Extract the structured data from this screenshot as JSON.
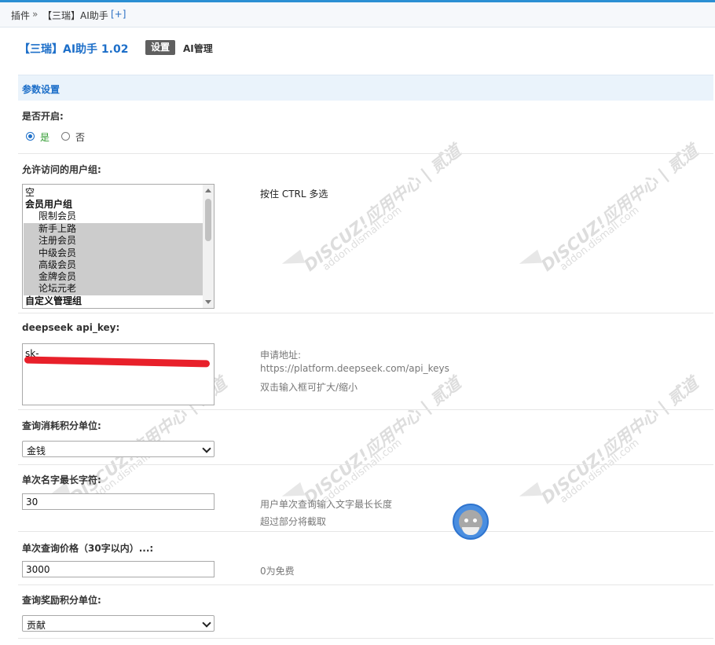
{
  "breadcrumb": {
    "plugins": "插件",
    "separator": "»",
    "current": "【三瑞】AI助手",
    "add": "[+]"
  },
  "header": {
    "title": "【三瑞】AI助手 1.02",
    "tabs": [
      {
        "label": "设置",
        "active": true
      },
      {
        "label": "AI管理",
        "active": false
      }
    ]
  },
  "section": {
    "title": "参数设置"
  },
  "fields": {
    "enable": {
      "label": "是否开启:",
      "options": [
        {
          "label": "是",
          "checked": true
        },
        {
          "label": "否",
          "checked": false
        }
      ]
    },
    "groups": {
      "label": "允许访问的用户组:",
      "hint": "按住 CTRL 多选",
      "options": [
        {
          "label": "空",
          "type": "plain",
          "selected": false
        },
        {
          "label": "会员用户组",
          "type": "group",
          "selected": false
        },
        {
          "label": "限制会员",
          "type": "sub",
          "selected": false
        },
        {
          "label": "新手上路",
          "type": "sub",
          "selected": true
        },
        {
          "label": "注册会员",
          "type": "sub",
          "selected": true
        },
        {
          "label": "中级会员",
          "type": "sub",
          "selected": true
        },
        {
          "label": "高级会员",
          "type": "sub",
          "selected": true
        },
        {
          "label": "金牌会员",
          "type": "sub",
          "selected": true
        },
        {
          "label": "论坛元老",
          "type": "sub",
          "selected": true
        },
        {
          "label": "自定义管理组",
          "type": "group",
          "selected": false
        }
      ]
    },
    "api_key": {
      "label": "deepseek api_key:",
      "value": "sk-",
      "hint_lines": [
        "申请地址:",
        "https://platform.deepseek.com/api_keys",
        "双击输入框可扩大/缩小"
      ]
    },
    "cost_unit": {
      "label": "查询消耗积分单位:",
      "value": "金钱"
    },
    "max_chars": {
      "label": "单次名字最长字符:",
      "value": "30",
      "hint_lines": [
        "用户单次查询输入文字最长长度",
        "超过部分将截取"
      ]
    },
    "price": {
      "label": "单次查询价格（30字以内）...:",
      "value": "3000",
      "hint": "0为免费"
    },
    "reward_unit": {
      "label": "查询奖励积分单位:",
      "value": "贡献"
    }
  },
  "watermark": {
    "brand": "DISCUZ!应用中心 | 贰道",
    "site": "addon.dismall.com"
  },
  "icons": {
    "mascot": "penguin-mascot-icon",
    "select_arrow": "chevron-down-icon"
  },
  "colors": {
    "accent": "#1d6fc9",
    "top_line": "#2b8fd3",
    "section_bg": "#eaf3fb",
    "tab_active_bg": "#5f5f5f",
    "selected_option_bg": "#cccccc",
    "redaction": "#e8202a"
  }
}
